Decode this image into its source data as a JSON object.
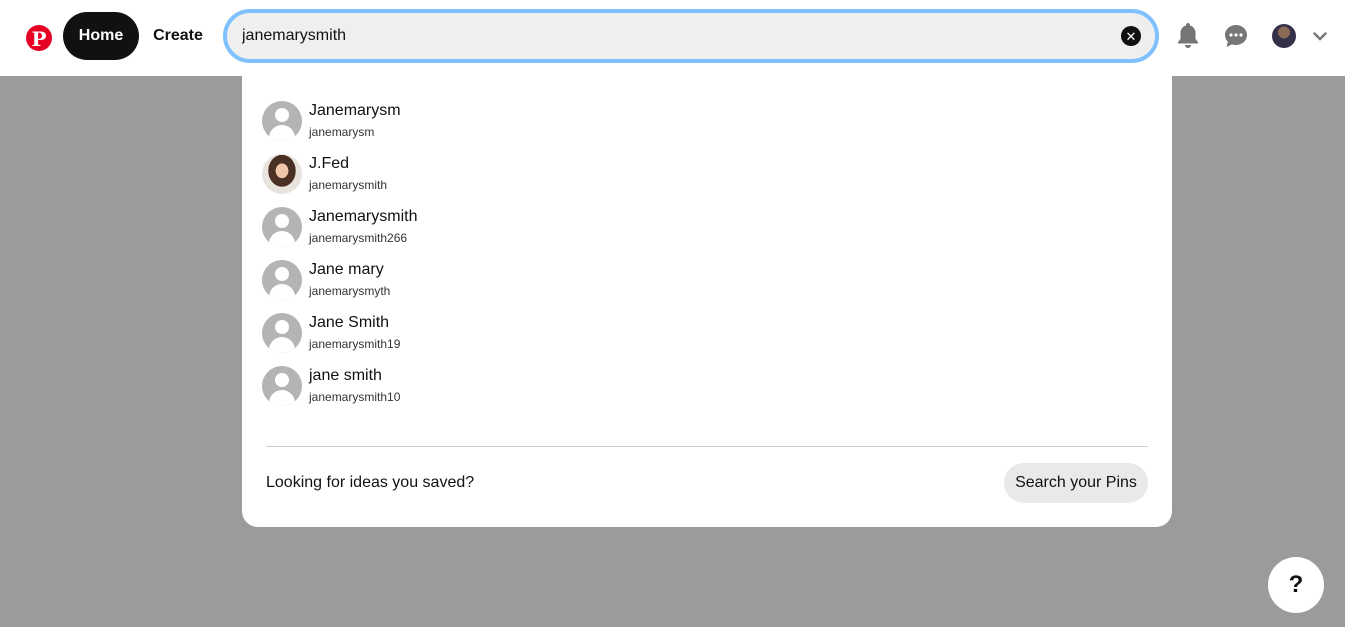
{
  "header": {
    "logo_glyph": "P",
    "nav": {
      "home_label": "Home",
      "create_label": "Create"
    },
    "search": {
      "value": "janemarysmith",
      "clear_glyph": "✕"
    },
    "icons": [
      "bell-icon",
      "messages-icon",
      "profile-avatar",
      "chevron-down-icon"
    ]
  },
  "dropdown": {
    "results": [
      {
        "name": "Janemarysm",
        "username": "janemarysm",
        "avatar": "default"
      },
      {
        "name": "J.Fed",
        "username": "janemarysmith",
        "avatar": "photo"
      },
      {
        "name": "Janemarysmith",
        "username": "janemarysmith266",
        "avatar": "default"
      },
      {
        "name": "Jane mary",
        "username": "janemarysmyth",
        "avatar": "default"
      },
      {
        "name": "Jane Smith",
        "username": "janemarysmith19",
        "avatar": "default"
      },
      {
        "name": "jane smith",
        "username": "janemarysmith10",
        "avatar": "default"
      }
    ],
    "footer_text": "Looking for ideas you saved?",
    "search_pins_label": "Search your Pins"
  },
  "help": {
    "glyph": "?"
  },
  "colors": {
    "brand": "#e60023",
    "focus_ring": "#7fc1ff",
    "overlay": "#9b9b9b"
  }
}
